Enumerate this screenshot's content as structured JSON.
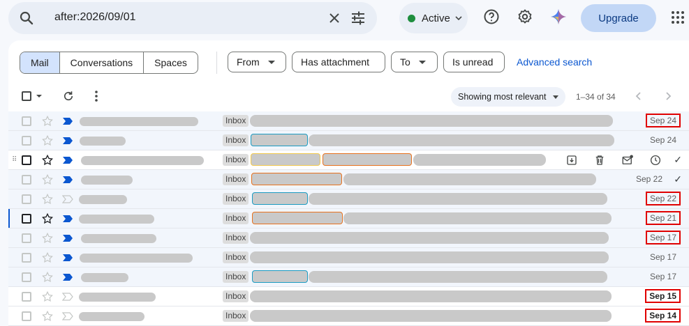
{
  "search": {
    "query": "after:2026/09/01"
  },
  "status": {
    "label": "Active",
    "color": "#1e8e3e"
  },
  "header": {
    "upgrade_label": "Upgrade"
  },
  "segments": [
    "Mail",
    "Conversations",
    "Spaces"
  ],
  "filters": {
    "from": "From",
    "has_attachment": "Has attachment",
    "to": "To",
    "is_unread": "Is unread",
    "advanced": "Advanced search"
  },
  "toolbar": {
    "sort_label": "Showing most relevant",
    "count": "1–34 of 34"
  },
  "rows": [
    {
      "label": "Inbox",
      "date": "Sep 24"
    },
    {
      "label": "Inbox",
      "date": "Sep 24"
    },
    {
      "label": "Inbox",
      "date": ""
    },
    {
      "label": "Inbox",
      "date": "Sep 22"
    },
    {
      "label": "Inbox",
      "date": "Sep 22"
    },
    {
      "label": "Inbox",
      "date": "Sep 21"
    },
    {
      "label": "Inbox",
      "date": "Sep 17"
    },
    {
      "label": "Inbox",
      "date": "Sep 17"
    },
    {
      "label": "Inbox",
      "date": "Sep 17"
    },
    {
      "label": "Inbox",
      "date": "Sep 15"
    },
    {
      "label": "Inbox",
      "date": "Sep 14"
    }
  ],
  "colors": {
    "accent": "#0b57d0",
    "highlight_box": "#e00000",
    "importance": "#0b57d0"
  }
}
